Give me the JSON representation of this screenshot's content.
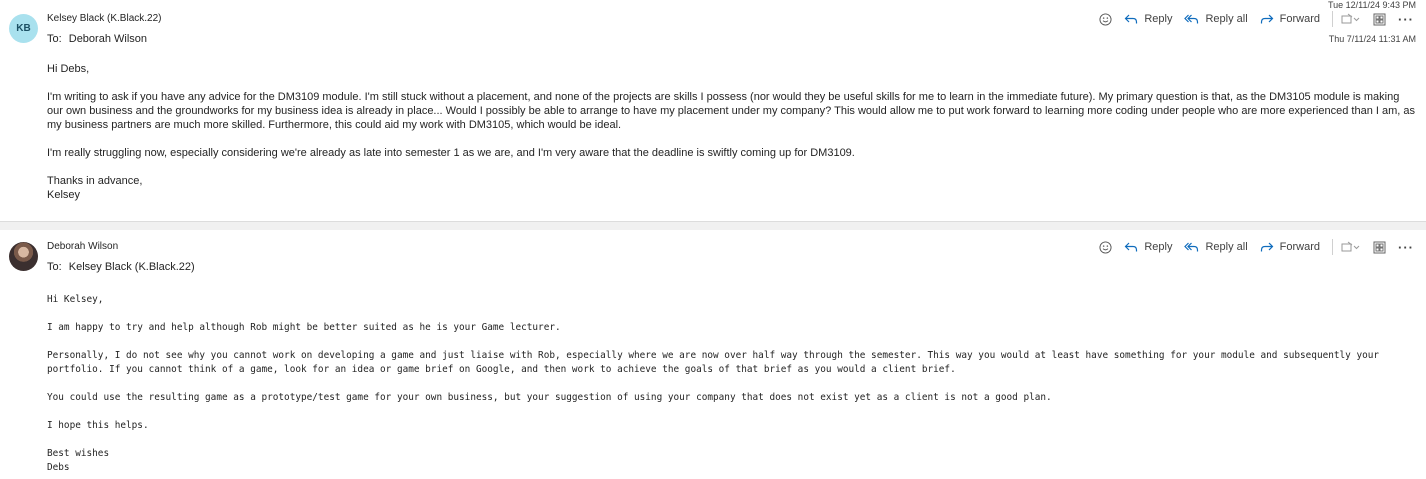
{
  "messages": [
    {
      "avatar_initials": "KB",
      "sender": "Kelsey Black (K.Black.22)",
      "to_label": "To:",
      "to": "Deborah Wilson",
      "date": "Thu 7/11/24 11:31 AM",
      "actions": {
        "reply": "Reply",
        "reply_all": "Reply all",
        "forward": "Forward"
      },
      "body": [
        "Hi Debs,",
        "I'm writing to ask if you have any advice for the DM3109 module. I'm still stuck without a placement, and none of the projects are skills I possess (nor would they be useful skills for me to learn in the immediate future). My primary question is that, as the DM3105 module is making our own business and the groundworks for my business idea is already in place... Would I possibly be able to arrange to have my placement under my company? This would allow me to put work forward to learning more coding under people who are more experienced than I am, as my business partners are much more skilled. Furthermore, this could aid my work with DM3105, which would be ideal.",
        "I'm really struggling now, especially considering we're already as late into semester 1 as we are, and I'm very aware that the deadline is swiftly coming up for DM3109.",
        "Thanks in advance,",
        "Kelsey"
      ]
    },
    {
      "avatar_icon": "profile-photo",
      "sender": "Deborah Wilson",
      "to_label": "To:",
      "to": "Kelsey Black (K.Black.22)",
      "date": "Tue 12/11/24 9:43 PM",
      "actions": {
        "reply": "Reply",
        "reply_all": "Reply all",
        "forward": "Forward"
      },
      "body": [
        "Hi Kelsey,",
        "I am happy to try and help although Rob might be better suited as he is your Game lecturer.",
        "Personally, I do not see why you cannot work on developing a game and just liaise with Rob, especially where we are now over half way through the semester. This way you would at least have something for your module and subsequently your portfolio. If you cannot think of a game, look for an idea or game brief on Google, and then work to achieve the goals of that brief as you would a client brief.",
        "You could use the resulting game as a prototype/test game for your own business, but your suggestion of using your company that does not exist yet as a client is not a good plan.",
        "I hope this helps.",
        "Best wishes",
        "Debs"
      ]
    }
  ],
  "colors": {
    "accent": "#0f6cbd",
    "avatar_kb_bg": "#a9e1ee",
    "background": "#f0f0f0"
  }
}
